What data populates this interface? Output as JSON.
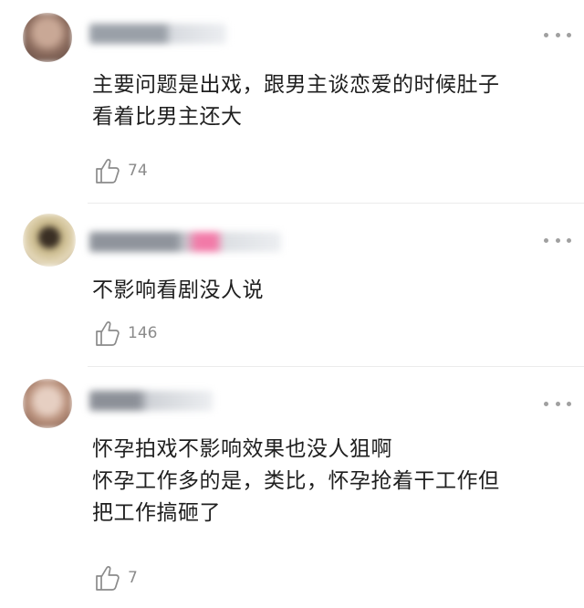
{
  "comments": [
    {
      "text": "主要问题是出戏，跟男主谈恋爱的时候肚子\n看着比男主还大",
      "likes": "74",
      "avatar_colors": [
        "#8a6a5c",
        "#c9a896",
        "#5f4a43"
      ]
    },
    {
      "text": "不影响看剧没人说",
      "likes": "146",
      "avatar_colors": [
        "#c9b98a",
        "#6b5b3c",
        "#e8dcc0"
      ]
    },
    {
      "text": "怀孕拍戏不影响效果也没人狙啊\n怀孕工作多的是，类比，怀孕抢着干工作但\n把工作搞砸了",
      "likes": "7",
      "avatar_colors": [
        "#b88f7a",
        "#e6cfc2",
        "#7d5e52"
      ]
    }
  ],
  "icons": {
    "like": "thumbs-up-icon",
    "more": "more-dots-icon"
  }
}
